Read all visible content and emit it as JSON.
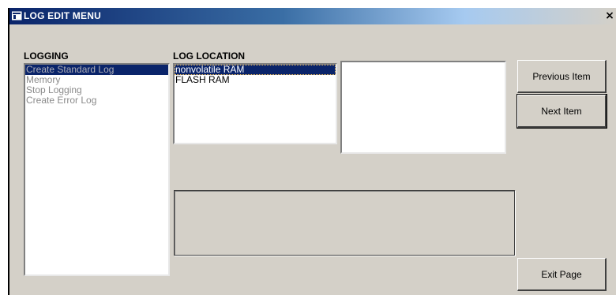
{
  "window": {
    "title": "LOG EDIT MENU",
    "close_glyph": "×",
    "icon": "window-app-icon"
  },
  "logging": {
    "label": "LOGGING",
    "items": [
      "Create Standard Log",
      "Memory",
      "Stop Logging",
      "Create Error Log"
    ]
  },
  "log_location": {
    "label": "LOG LOCATION",
    "items": [
      "nonvolatile RAM",
      "FLASH RAM"
    ]
  },
  "buttons": {
    "previous": "Previous Item",
    "next": "Next Item",
    "exit": "Exit Page"
  },
  "colors": {
    "titlebar_start": "#0a246a",
    "face": "#d4d0c8",
    "selection": "#0a246a"
  }
}
